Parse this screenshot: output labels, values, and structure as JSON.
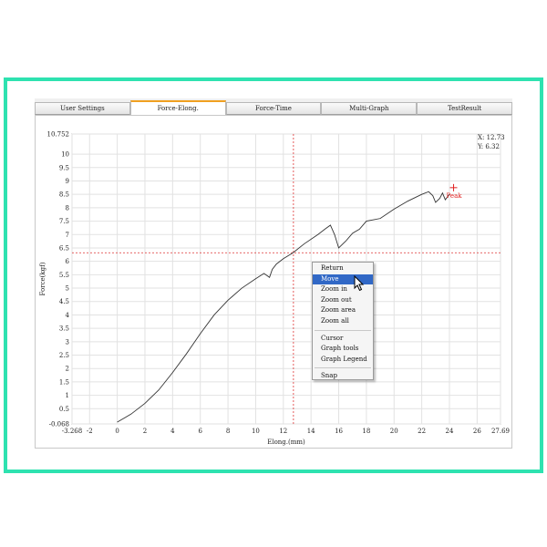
{
  "tabs": [
    {
      "label": "User Settings",
      "active": false
    },
    {
      "label": "Force-Elong.",
      "active": true
    },
    {
      "label": "Force-Time",
      "active": false
    },
    {
      "label": "Multi-Graph",
      "active": false
    },
    {
      "label": "TestResult",
      "active": false
    }
  ],
  "readout": {
    "x": "X: 12.73",
    "y": "Y: 6.32"
  },
  "context_menu": {
    "items": [
      {
        "label": "Return",
        "highlighted": false
      },
      {
        "label": "Move",
        "highlighted": true
      },
      {
        "label": "Zoom in",
        "highlighted": false
      },
      {
        "label": "Zoom out",
        "highlighted": false
      },
      {
        "label": "Zoom area",
        "highlighted": false
      },
      {
        "label": "Zoom all",
        "highlighted": false
      },
      {
        "separator": true
      },
      {
        "label": "Cursor",
        "highlighted": false
      },
      {
        "label": "Graph tools",
        "highlighted": false
      },
      {
        "label": "Graph Legend",
        "highlighted": false
      },
      {
        "separator": true
      },
      {
        "label": "Snap",
        "highlighted": false
      }
    ]
  },
  "colors": {
    "frame": "#2ee2b0",
    "curve": "#333333",
    "crosshair": "#dd3333",
    "peak": "#e02020",
    "menu_highlight": "#3168c6",
    "active_tab_accent": "#f0a020"
  },
  "chart_data": {
    "type": "line",
    "xlabel": "Elong.(mm)",
    "ylabel": "Force(kgf)",
    "xlim": [
      -3.268,
      27.69
    ],
    "ylim": [
      -0.068,
      10.752
    ],
    "x_ticks": [
      -3.268,
      -2,
      0,
      2,
      4,
      6,
      8,
      10,
      12,
      14,
      16,
      18,
      20,
      22,
      24,
      26,
      27.69
    ],
    "y_ticks": [
      -0.068,
      0.5,
      1,
      1.5,
      2,
      2.5,
      3,
      3.5,
      4,
      4.5,
      5,
      5.5,
      6,
      6.5,
      7,
      7.5,
      8,
      8.5,
      9,
      9.5,
      10,
      10.752
    ],
    "x_tick_labels": [
      "-3.268",
      "-2",
      "0",
      "2",
      "4",
      "6",
      "8",
      "10",
      "12",
      "14",
      "16",
      "18",
      "20",
      "22",
      "24",
      "26",
      "27.69"
    ],
    "y_tick_labels": [
      "-0.068",
      "0.5",
      "1",
      "1.5",
      "2",
      "2.5",
      "3",
      "3.5",
      "4",
      "4.5",
      "5",
      "5.5",
      "6",
      "6.5",
      "7",
      "7.5",
      "8",
      "8.5",
      "9",
      "9.5",
      "10",
      "10.752"
    ],
    "grid": true,
    "series": [
      {
        "x": [
          0,
          0.5,
          1,
          2,
          3,
          4,
          5,
          6,
          7,
          8,
          9,
          10,
          10.6,
          11,
          11.2,
          11.5,
          12,
          12.7,
          13.5,
          14.5,
          15,
          15.4,
          15.7,
          16,
          16.5,
          17,
          17.5,
          18,
          19,
          20,
          21,
          22,
          22.5,
          22.8,
          23.0,
          23.3,
          23.5,
          23.7,
          24.0
        ],
        "y": [
          0,
          0.15,
          0.3,
          0.7,
          1.2,
          1.85,
          2.55,
          3.3,
          4.0,
          4.55,
          5.0,
          5.35,
          5.55,
          5.4,
          5.7,
          5.9,
          6.1,
          6.32,
          6.65,
          7.0,
          7.2,
          7.35,
          7.0,
          6.5,
          6.75,
          7.05,
          7.2,
          7.5,
          7.6,
          7.95,
          8.25,
          8.5,
          8.6,
          8.45,
          8.2,
          8.35,
          8.55,
          8.3,
          8.5
        ]
      }
    ],
    "crosshair": {
      "x": 12.73,
      "y": 6.32
    },
    "annotations": [
      {
        "label": "Peak",
        "x": 24.3,
        "y": 8.75
      }
    ]
  }
}
